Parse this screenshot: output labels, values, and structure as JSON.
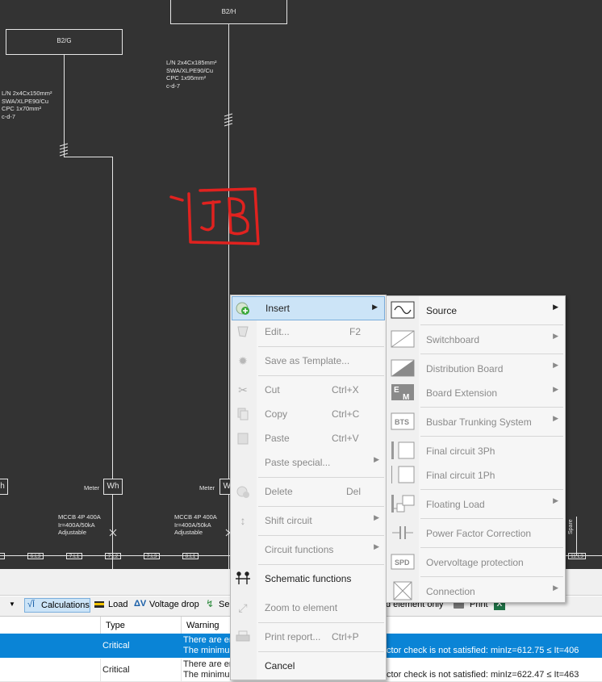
{
  "schematic": {
    "boards": [
      {
        "label": "B2/H"
      },
      {
        "label": "B2/G"
      }
    ],
    "cables": [
      {
        "spec": "L/N 2x4Cx185mm²\nSWA/XLPE90/Cu\nCPC 1x95mm²\nc-d-7"
      },
      {
        "spec": "L/N 2x4Cx150mm²\nSWA/XLPE90/Cu\nCPC 1x70mm²\nc-d-7"
      }
    ],
    "meters": [
      {
        "caption": "Meter",
        "symbol": "Wh"
      },
      {
        "caption": "Meter",
        "symbol": "Wh"
      }
    ],
    "left_edge_symbol": "h",
    "breakers": [
      {
        "spec": "MCCB 4P 400A\nIr=400A/50kA\nAdjustable"
      },
      {
        "spec": "MCCB 4P 400A\nIr=400A/50kA\nAdjustable"
      }
    ],
    "bus_labels": [
      "6.L3",
      "7.L1",
      "7.L2",
      "7.L3",
      "8.L1",
      "11.L3"
    ],
    "spare_label": "Spare",
    "annotation": "JB"
  },
  "toolbar": {
    "calculations": "Calculations",
    "load": "Load",
    "voltage_drop": "Voltage drop",
    "truncated": "Se",
    "selected_only": "d element only",
    "print": "Print"
  },
  "warnings_table": {
    "headers": [
      "Type",
      "Warning"
    ],
    "rows": [
      {
        "type": "Critical",
        "warning_l1": "There are er",
        "warning_l2": "The minimum",
        "tail": "ctor check is not satisfied: minIz=612.75 ≤ It=406",
        "selected": true
      },
      {
        "type": "Critical",
        "warning_l1": "There are er",
        "warning_l2": "The minimum",
        "tail": "ctor check is not satisfied: minIz=622.47 ≤ It=463",
        "selected": false
      }
    ]
  },
  "context_menu": {
    "items": [
      {
        "label": "Insert",
        "shortcut": "",
        "submenu": true,
        "disabled": false,
        "icon": "insert-icon"
      },
      {
        "label": "Edit...",
        "shortcut": "F2",
        "submenu": false,
        "disabled": true,
        "icon": "edit-icon"
      },
      {
        "label": "Save as Template...",
        "shortcut": "",
        "submenu": false,
        "disabled": true,
        "icon": "gear-icon"
      },
      {
        "label": "Cut",
        "shortcut": "Ctrl+X",
        "submenu": false,
        "disabled": true,
        "icon": "scissors-icon"
      },
      {
        "label": "Copy",
        "shortcut": "Ctrl+C",
        "submenu": false,
        "disabled": true,
        "icon": "copy-icon"
      },
      {
        "label": "Paste",
        "shortcut": "Ctrl+V",
        "submenu": false,
        "disabled": true,
        "icon": "paste-icon"
      },
      {
        "label": "Paste special...",
        "shortcut": "",
        "submenu": true,
        "disabled": true,
        "icon": ""
      },
      {
        "label": "Delete",
        "shortcut": "Del",
        "submenu": false,
        "disabled": true,
        "icon": "delete-icon"
      },
      {
        "label": "Shift circuit",
        "shortcut": "",
        "submenu": true,
        "disabled": true,
        "icon": "shift-icon"
      },
      {
        "label": "Circuit functions",
        "shortcut": "",
        "submenu": true,
        "disabled": true,
        "icon": ""
      },
      {
        "label": "Schematic functions",
        "shortcut": "",
        "submenu": false,
        "disabled": false,
        "icon": "schematic-icon"
      },
      {
        "label": "Zoom to element",
        "shortcut": "",
        "submenu": false,
        "disabled": true,
        "icon": "zoom-icon"
      },
      {
        "label": "Print report...",
        "shortcut": "Ctrl+P",
        "submenu": false,
        "disabled": true,
        "icon": "printer-icon"
      },
      {
        "label": "Cancel",
        "shortcut": "",
        "submenu": false,
        "disabled": false,
        "icon": ""
      }
    ]
  },
  "insert_submenu": {
    "items": [
      {
        "label": "Source",
        "submenu": true,
        "disabled": false,
        "icon": "source-icon"
      },
      {
        "label": "Switchboard",
        "submenu": true,
        "disabled": true,
        "icon": "switchboard-icon"
      },
      {
        "label": "Distribution Board",
        "submenu": true,
        "disabled": true,
        "icon": "distribution-board-icon"
      },
      {
        "label": "Board Extension",
        "submenu": true,
        "disabled": true,
        "icon": "board-extension-icon"
      },
      {
        "label": "Busbar Trunking System",
        "submenu": true,
        "disabled": true,
        "icon": "bts-icon"
      },
      {
        "label": "Final circuit 3Ph",
        "submenu": false,
        "disabled": true,
        "icon": "final-circuit-3ph-icon"
      },
      {
        "label": "Final circuit 1Ph",
        "submenu": false,
        "disabled": true,
        "icon": "final-circuit-1ph-icon"
      },
      {
        "label": "Floating Load",
        "submenu": true,
        "disabled": true,
        "icon": "floating-load-icon"
      },
      {
        "label": "Power Factor Correction",
        "submenu": false,
        "disabled": true,
        "icon": "capacitor-icon"
      },
      {
        "label": "Overvoltage protection",
        "submenu": false,
        "disabled": true,
        "icon": "spd-icon"
      },
      {
        "label": "Connection",
        "submenu": true,
        "disabled": true,
        "icon": "connection-icon"
      }
    ],
    "bts_text": "BTS",
    "spd_text": "SPD",
    "em_text_e": "E",
    "em_text_m": "M"
  },
  "colors": {
    "canvas": "#333333",
    "wire": "#e6e6e6",
    "annotation": "#e0221f",
    "menu_highlight": "#cce4f7",
    "row_selected": "#0a84d6"
  }
}
